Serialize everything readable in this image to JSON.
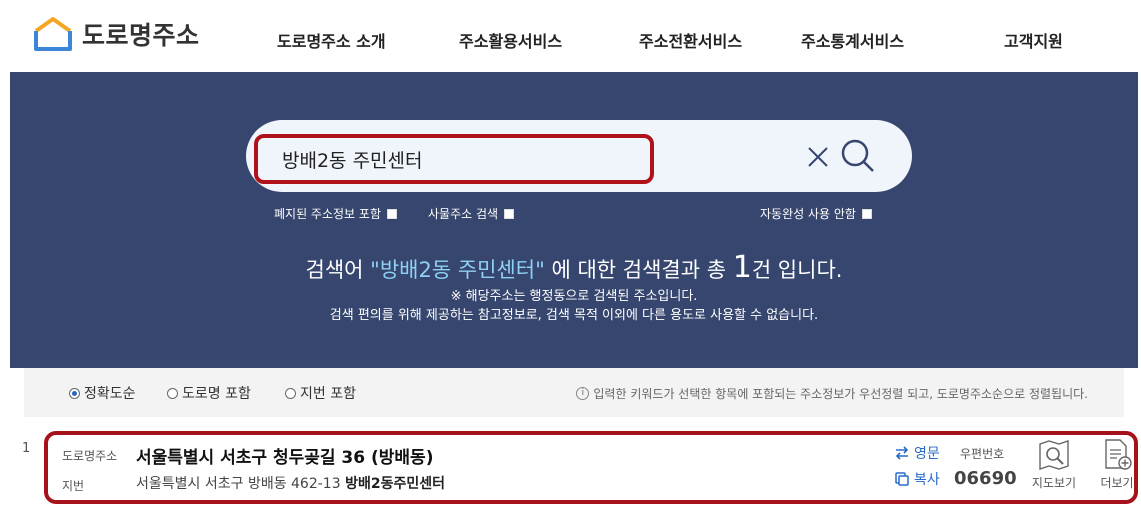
{
  "header": {
    "logo_text": "도로명주소",
    "nav": [
      "도로명주소 소개",
      "주소활용서비스",
      "주소전환서비스",
      "주소통계서비스",
      "고객지원"
    ]
  },
  "search": {
    "query": "방배2동 주민센터",
    "options": {
      "abolished": "폐지된 주소정보 포함",
      "building": "사물주소 검색",
      "autocomplete_off": "자동완성 사용 안함"
    }
  },
  "summary": {
    "prefix": "검색어 ",
    "keyword": "\"방배2동 주민센터\"",
    "middle": " 에 대한 검색결과 총 ",
    "count": "1",
    "suffix": "건 입니다.",
    "note1": "※ 해당주소는 행정동으로 검색된 주소입니다.",
    "note2": "검색 편의를 위해 제공하는 참고정보로, 검색 목적 이외에 다른 용도로 사용할 수 없습니다."
  },
  "filters": {
    "options": [
      "정확도순",
      "도로명 포함",
      "지번 포함"
    ],
    "selected": "정확도순",
    "hint": "입력한 키워드가 선택한 항목에 포함되는 주소정보가 우선정렬 되고, 도로명주소순으로 정렬됩니다."
  },
  "results": [
    {
      "index": "1",
      "road_label": "도로명주소",
      "road_address": "서울특별시 서초구 청두곶길 36 (방배동)",
      "jibun_label": "지번",
      "jibun_address": "서울특별시 서초구 방배동 462-13",
      "building_name": "방배2동주민센터",
      "english_label": "영문",
      "copy_label": "복사",
      "postal_label": "우편번호",
      "postal_code": "06690",
      "map_label": "지도보기",
      "more_label": "더보기"
    }
  ],
  "colors": {
    "hero_bg": "#36466e",
    "highlight_border": "#a5121b",
    "keyword": "#8fd0f5",
    "link": "#2a6ac8"
  }
}
